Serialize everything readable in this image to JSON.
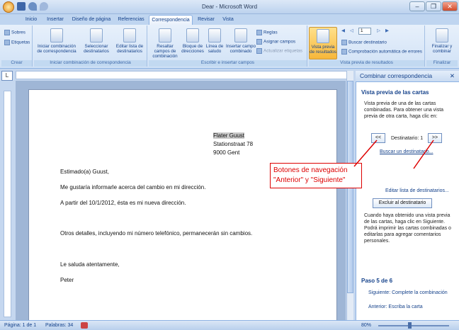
{
  "window": {
    "title": "Dear - Microsoft Word",
    "minimize": "–",
    "restore": "❐",
    "close": "✕"
  },
  "tabs": [
    "Inicio",
    "Insertar",
    "Diseño de página",
    "Referencias",
    "Correspondencia",
    "Revisar",
    "Vista"
  ],
  "ribbon": {
    "crear": {
      "label": "Crear",
      "sobres": "Sobres",
      "etiquetas": "Etiquetas"
    },
    "iniciar": {
      "label": "Iniciar combinación de correspondencia",
      "btn1": "Iniciar combinación de correspondencia",
      "btn2": "Seleccionar destinatarios",
      "btn3": "Editar lista de destinatarios"
    },
    "escribir": {
      "label": "Escribir e insertar campos",
      "btn1": "Resaltar campos de combinación",
      "btn2": "Bloque de direcciones",
      "btn3": "Línea de saludo",
      "btn4": "Insertar campo combinado",
      "reglas": "Reglas",
      "asignar": "Asignar campos",
      "actualizar": "Actualizar etiquetas"
    },
    "vista": {
      "label": "Vista previa de resultados",
      "btn": "Vista previa de resultados",
      "record": "1",
      "buscar": "Buscar destinatario",
      "comprobacion": "Comprobación automática de errores"
    },
    "finalizar": {
      "label": "Finalizar",
      "btn": "Finalizar y combinar"
    }
  },
  "document": {
    "address": [
      "Flater Guust",
      "Stationstraat 78",
      "9000 Gent"
    ],
    "greeting": "Estimado(a) Guust,",
    "p1": "Me gustaría informarle acerca del cambio en mi dirección.",
    "p2": "A partir del 10/1/2012,  ésta es mi nueva dirección.",
    "p3": "Otros detalles, incluyendo mi número telefónico, permanecerán sin cambios.",
    "closing": "Le saluda atentamente,",
    "signature": "Peter"
  },
  "pane": {
    "title": "Combinar correspondencia",
    "section": "Vista previa de las cartas",
    "desc": "Vista previa de una de las cartas combinadas. Para obtener una vista previa de otra carta, haga clic en:",
    "prev_btn": "<<",
    "next_btn": ">>",
    "recipient": "Destinatario: 1",
    "find_link": "Buscar un destinatario...",
    "edit_link": "Editar lista de destinatarios...",
    "exclude_btn": "Excluir al destinatario",
    "done_text": "Cuando haya obtenido una vista previa de las cartas, haga clic en Siguiente. Podrá imprimir las cartas combinadas o editarlas para agregar comentarios personales.",
    "step": "Paso 5 de 6",
    "next_link": "Siguiente: Complete la combinación",
    "prev_link": "Anterior: Escriba la carta"
  },
  "callout": {
    "line1": "Botones de navegación",
    "line2": "\"Anterior\" y \"Siguiente\""
  },
  "status": {
    "page": "Página: 1 de 1",
    "words": "Palabras: 34",
    "zoom": "80%"
  }
}
